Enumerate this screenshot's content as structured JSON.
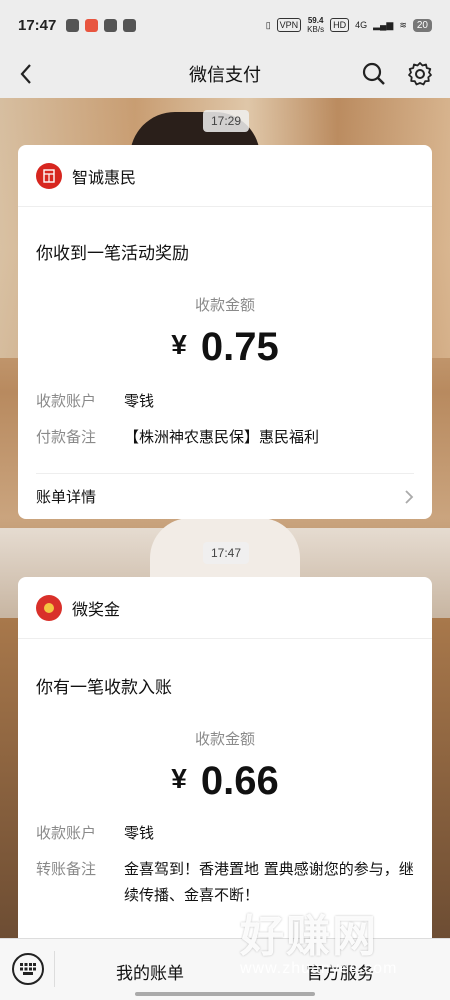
{
  "status_bar": {
    "time": "17:47",
    "vpn": "VPN",
    "speed_value": "59.4",
    "speed_unit": "KB/s",
    "hd": "HD",
    "network": "4G",
    "battery": "20"
  },
  "nav": {
    "title": "微信支付"
  },
  "messages": [
    {
      "timestamp": "17:29",
      "brand": "智诚惠民",
      "text": "你收到一笔活动奖励",
      "amount_label": "收款金额",
      "currency": "¥",
      "amount": "0.75",
      "fields": [
        {
          "key": "收款账户",
          "value": "零钱"
        },
        {
          "key": "付款备注",
          "value": "【株洲神农惠民保】惠民福利"
        }
      ],
      "detail_label": "账单详情"
    },
    {
      "timestamp": "17:47",
      "brand": "微奖金",
      "text": "你有一笔收款入账",
      "amount_label": "收款金额",
      "currency": "¥",
      "amount": "0.66",
      "fields": [
        {
          "key": "收款账户",
          "value": "零钱"
        },
        {
          "key": "转账备注",
          "value": "金喜驾到！香港置地 置典感谢您的参与，继续传播、金喜不断！"
        }
      ]
    }
  ],
  "bottom_bar": {
    "tab_bills": "我的账单",
    "tab_service": "官方服务"
  },
  "watermark": {
    "big": "好赚网",
    "small": "www.zhuanyes.com"
  },
  "colors": {
    "accent_red": "#d7261f",
    "background": "#ededed"
  }
}
